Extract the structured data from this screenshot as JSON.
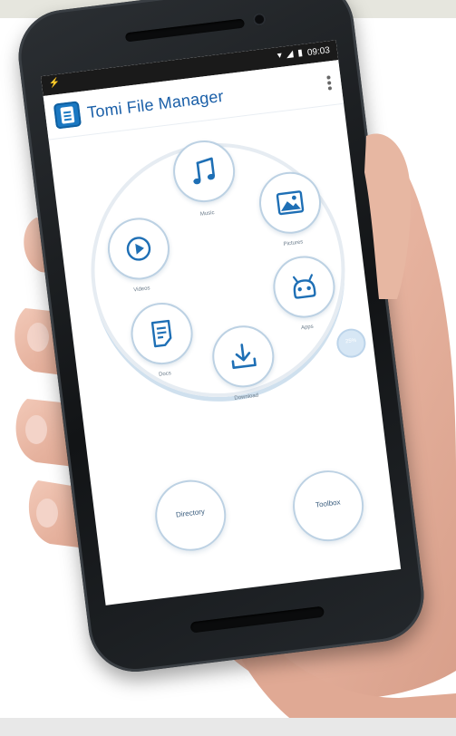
{
  "app": {
    "title": "Tomi File Manager"
  },
  "status_bar": {
    "time": "09:03",
    "left_icon": "usb-icon"
  },
  "categories": [
    {
      "label": "Music",
      "icon": "music-note-icon"
    },
    {
      "label": "Pictures",
      "icon": "image-icon"
    },
    {
      "label": "Apps",
      "icon": "android-icon"
    },
    {
      "label": "Download",
      "icon": "download-icon"
    },
    {
      "label": "Docs",
      "icon": "document-icon"
    },
    {
      "label": "Videos",
      "icon": "play-icon"
    }
  ],
  "storage_badge": {
    "label": "25%"
  },
  "bottom_buttons": {
    "directory": "Directory",
    "toolbox": "Toolbox"
  },
  "colors": {
    "accent": "#1a78c2",
    "icon_blue": "#1e6fb5",
    "ring": "#e6ecf2",
    "node_border": "#bcd1e3"
  }
}
